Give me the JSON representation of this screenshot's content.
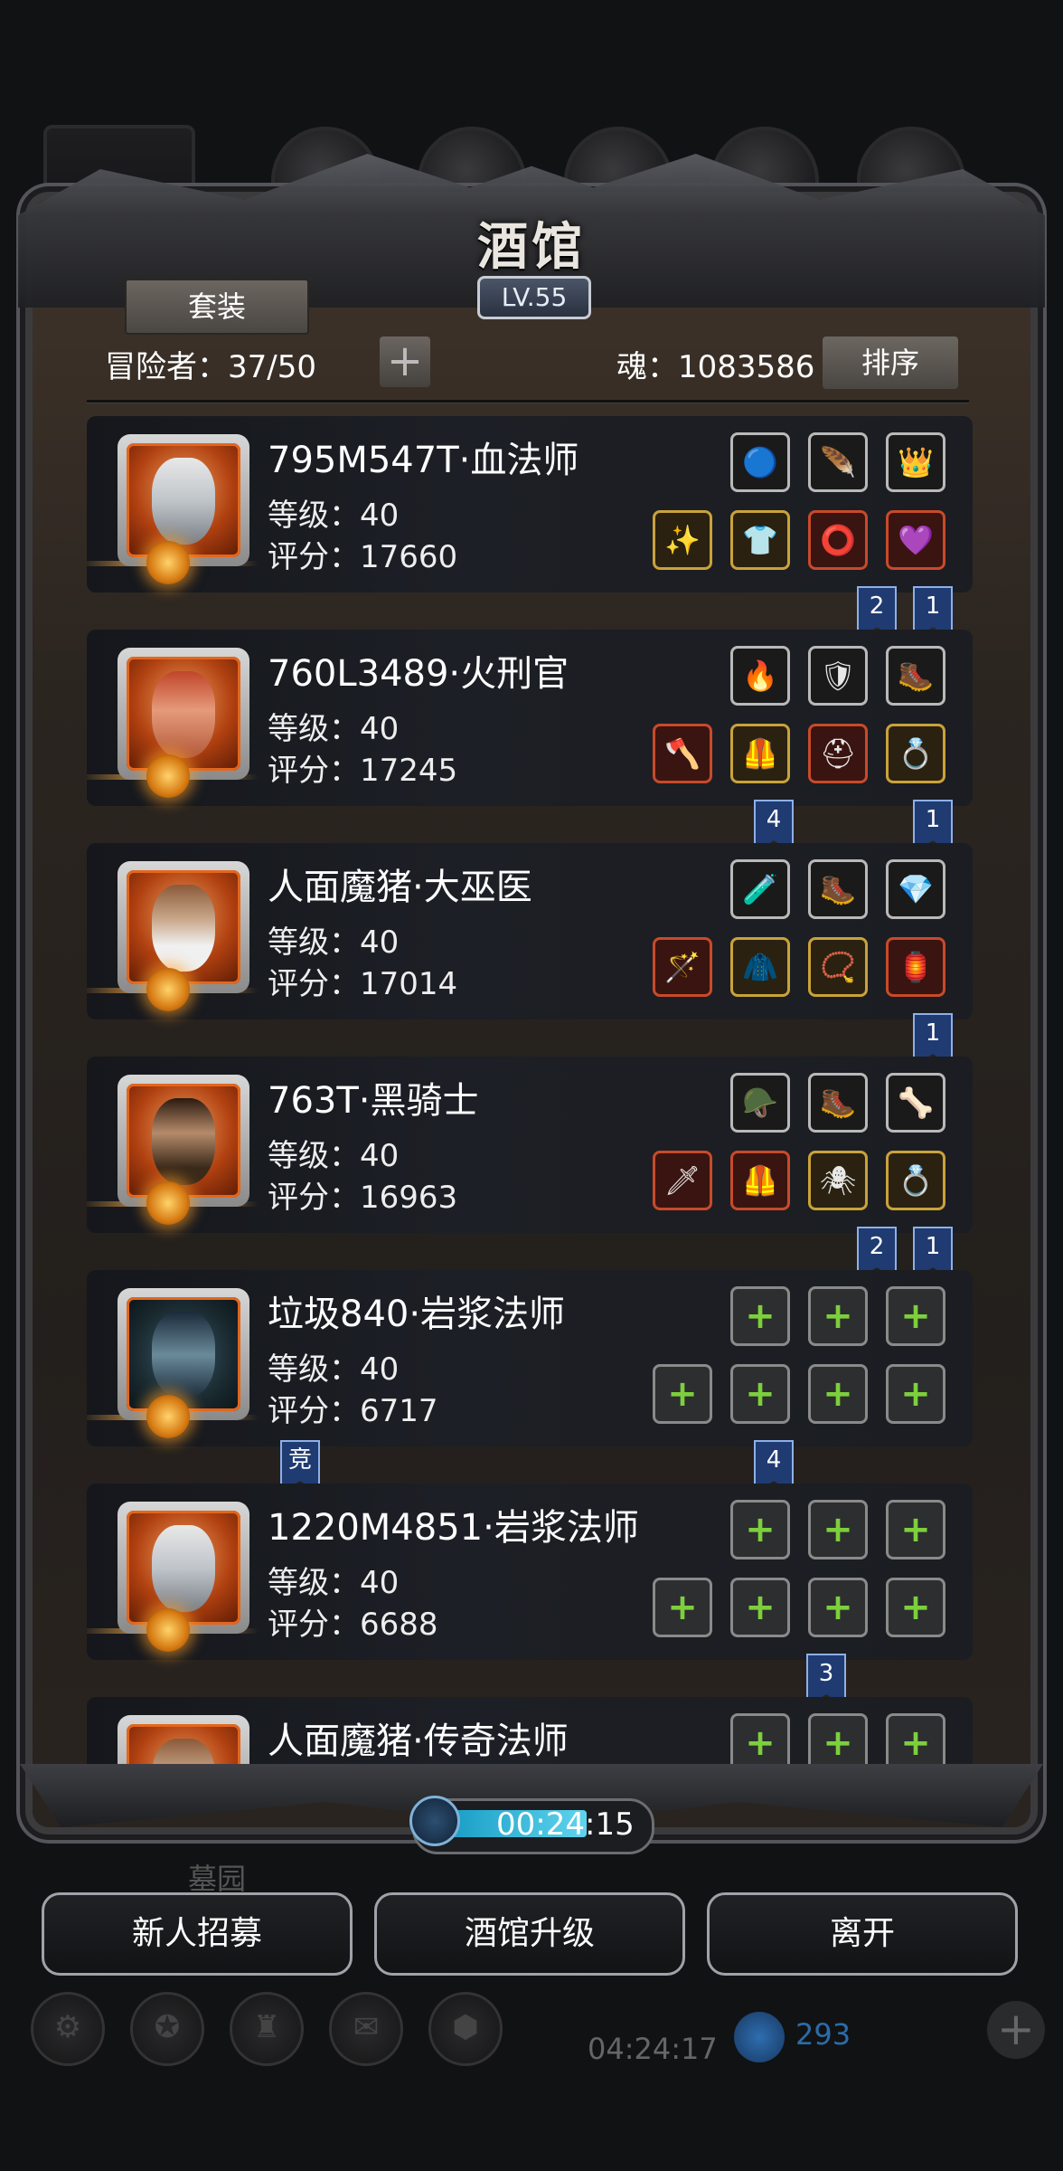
{
  "header": {
    "title": "酒馆",
    "level": "LV.55",
    "suit_button": "套装",
    "adventurers": "冒险者：37/50",
    "plus": "+",
    "soul": "魂：1083586",
    "sort_button": "排序"
  },
  "heroes": [
    {
      "name": "795M547T·血法师",
      "level": "等级：40",
      "score": "评分：17660",
      "tags": [
        "2",
        "1"
      ]
    },
    {
      "name": "760L3489·火刑官",
      "level": "等级：40",
      "score": "评分：17245",
      "tags": [
        "4",
        "1"
      ]
    },
    {
      "name": "人面魔猪·大巫医",
      "level": "等级：40",
      "score": "评分：17014",
      "tags": [
        "1"
      ]
    },
    {
      "name": "763T·黑骑士",
      "level": "等级：40",
      "score": "评分：16963",
      "tags": [
        "2",
        "1"
      ]
    },
    {
      "name": "垃圾840·岩浆法师",
      "level": "等级：40",
      "score": "评分：6717",
      "tags": [
        "竞",
        "4"
      ]
    },
    {
      "name": "1220M4851·岩浆法师",
      "level": "等级：40",
      "score": "评分：6688",
      "tags": [
        "3"
      ]
    },
    {
      "name": "人面魔猪·传奇法师",
      "level": "",
      "score": "",
      "tags": []
    }
  ],
  "timer": "00:24:15",
  "bottom": {
    "recruit": "新人招募",
    "upgrade": "酒馆升级",
    "leave": "离开",
    "bg_label": "墓园"
  },
  "hud": {
    "time": "04:24:17",
    "gems": "293",
    "plus": "+"
  },
  "colors": {
    "panel": "#2b2520",
    "tag": "#1f3b72",
    "timer": "#1a9ec6",
    "empty_plus": "#7dcf3c"
  }
}
